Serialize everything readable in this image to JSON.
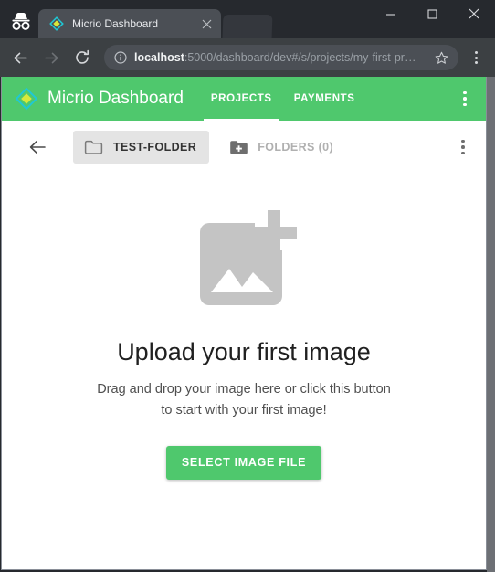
{
  "browser": {
    "incognito_icon": "incognito-icon",
    "tab": {
      "favicon": "micrio-diamond-favicon",
      "title": "Micrio Dashboard",
      "close_icon": "close-icon"
    },
    "window_controls": {
      "minimize_icon": "minimize-icon",
      "maximize_icon": "maximize-icon",
      "close_icon": "close-icon"
    },
    "nav": {
      "back_icon": "back-arrow-icon",
      "forward_icon": "forward-arrow-icon",
      "reload_icon": "reload-icon",
      "menu_icon": "kebab-menu-icon"
    },
    "omnibox": {
      "info_icon": "page-info-icon",
      "url_host": "localhost",
      "url_rest": ":5000/dashboard/dev#/s/projects/my-first-pr…",
      "star_icon": "bookmark-star-icon"
    }
  },
  "app": {
    "logo_icon": "micrio-diamond-logo",
    "title": "Micrio Dashboard",
    "tabs": [
      {
        "label": "PROJECTS",
        "active": true
      },
      {
        "label": "PAYMENTS",
        "active": false
      }
    ],
    "overflow_menu_icon": "kebab-menu-icon"
  },
  "folder_bar": {
    "back_icon": "back-arrow-icon",
    "current_folder": {
      "icon": "folder-outline-icon",
      "label": "TEST-FOLDER"
    },
    "folders_button": {
      "icon": "folder-add-icon",
      "label": "FOLDERS (0)"
    },
    "overflow_menu_icon": "kebab-menu-icon"
  },
  "empty_state": {
    "icon": "add-photo-icon",
    "heading": "Upload your first image",
    "description": "Drag and drop your image here or click this button to start with your first image!",
    "button_label": "SELECT IMAGE FILE"
  },
  "colors": {
    "brand_green": "#4fc86d",
    "chip_gray": "#e4e4e4",
    "placeholder_gray": "#c4c4c4",
    "muted_text": "#b0b0b0",
    "browser_chrome": "#26292e",
    "toolbar": "#3c4043"
  }
}
